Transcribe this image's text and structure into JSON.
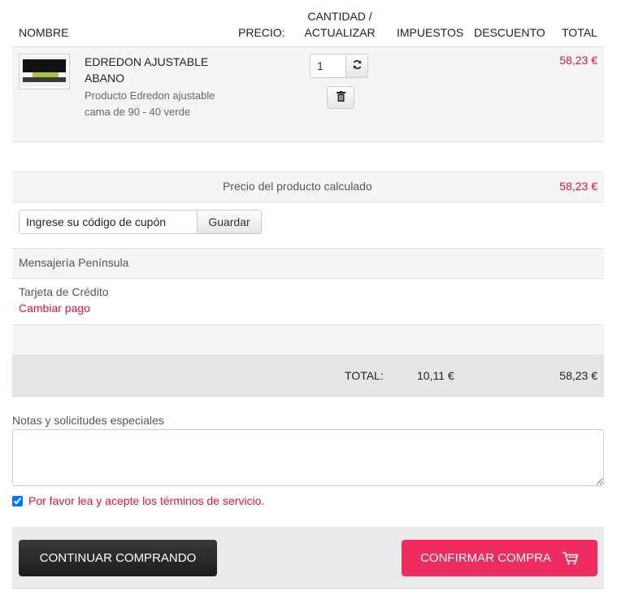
{
  "table_header": {
    "name": "NOMBRE",
    "price": "PRECIO:",
    "qty_line1": "CANTIDAD /",
    "qty_line2": "ACTUALIZAR",
    "tax": "IMPUESTOS",
    "discount": "DESCUENTO",
    "total": "TOTAL"
  },
  "product": {
    "name": "EDREDON AJUSTABLE ABANO",
    "description": "Producto Edredon ajustable cama de 90 - 40 verde",
    "quantity": "1",
    "total": "58,23 €",
    "image_icon": "product-thumbnail",
    "refresh_icon": "refresh-icon",
    "trash_icon": "trash-icon"
  },
  "calculated": {
    "label": "Precio del producto calculado",
    "value": "58,23 €"
  },
  "coupon": {
    "placeholder": "Ingrese su código de cupón",
    "button": "Guardar"
  },
  "shipping": {
    "label": "Mensajería Península"
  },
  "payment": {
    "label": "Tarjeta de Crédito",
    "change_link": "Cambiar pago"
  },
  "totals": {
    "label": "TOTAL:",
    "tax": "10,11 €",
    "total": "58,23 €"
  },
  "notes": {
    "label": "Notas y solicitudes especiales",
    "value": ""
  },
  "terms": {
    "checked": true,
    "text": "Por favor lea y acepte los términos de servicio."
  },
  "actions": {
    "continue": "CONTINUAR COMPRANDO",
    "confirm": "CONFIRMAR COMPRA",
    "cart_icon": "cart-icon"
  },
  "colors": {
    "accent": "#e0143c",
    "confirm_button": "#ee2c60",
    "continue_button": "#2a2a2a",
    "row_alt": "#f5f5f5",
    "total_row": "#e6e6e6"
  }
}
